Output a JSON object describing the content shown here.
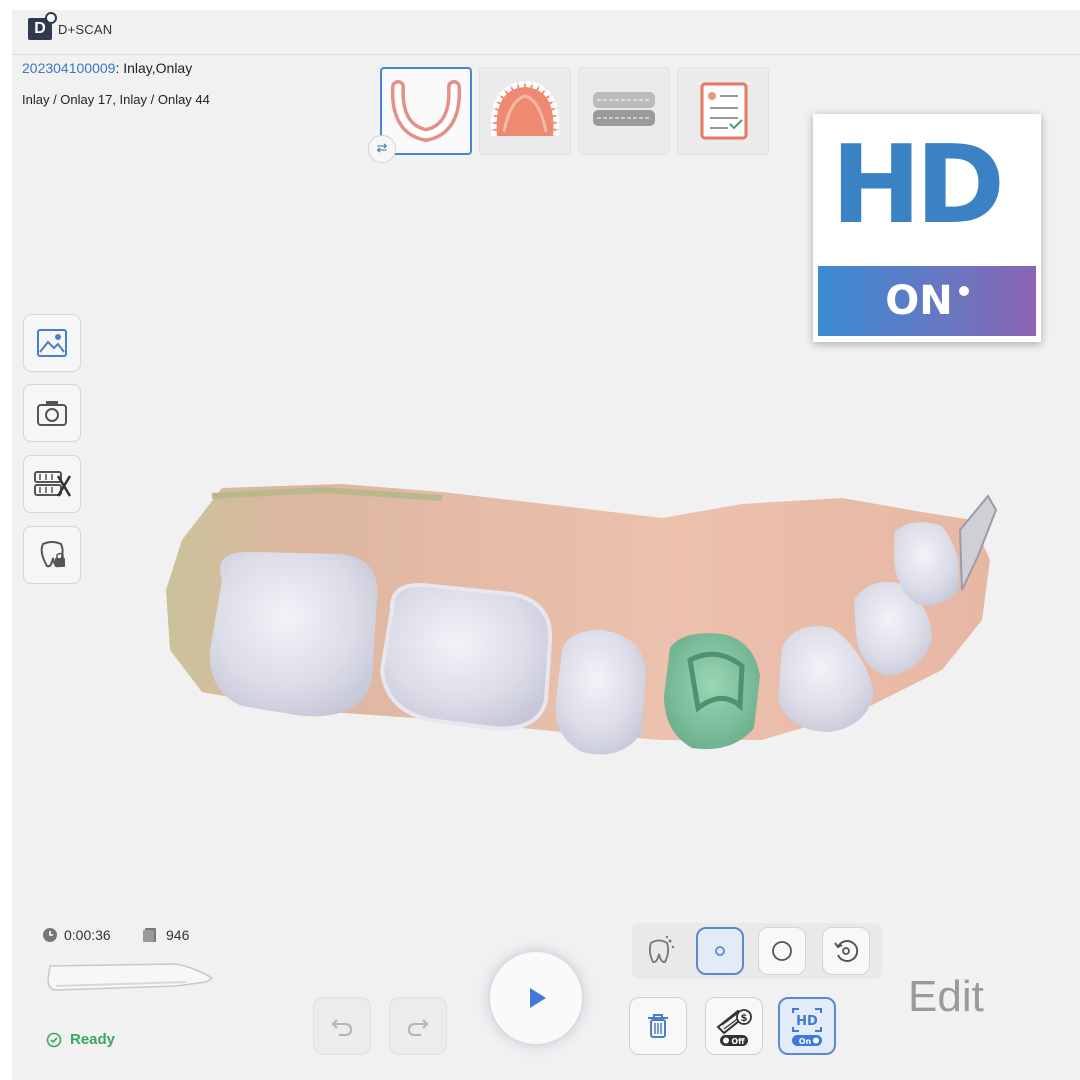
{
  "app": {
    "name": "D+SCAN",
    "logo_letter": "D"
  },
  "case": {
    "id": "202304100009",
    "separator": ":",
    "types": "Inlay,Onlay",
    "detail": "Inlay / Onlay 17, Inlay / Onlay 44"
  },
  "tabs": [
    {
      "name": "lower-jaw",
      "active": true
    },
    {
      "name": "upper-jaw",
      "active": false
    },
    {
      "name": "occlusion",
      "active": false
    },
    {
      "name": "order-form",
      "active": false
    }
  ],
  "hd_badge": {
    "title": "HD",
    "status": "ON"
  },
  "left_tools": [
    "image-icon",
    "camera-icon",
    "trim-icon",
    "tooth-lock-icon"
  ],
  "status": {
    "timer": "0:00:36",
    "frames": "946",
    "ready": "Ready"
  },
  "bottom_tools": {
    "ai_filter_label": "$",
    "ai_filter_state": "Off",
    "hd_label": "HD",
    "hd_state": "On"
  },
  "mode": {
    "label": "Edit"
  },
  "colors": {
    "accent": "#4a84d6",
    "ready": "#3aa564",
    "id_link": "#3c78c3",
    "selected_tooth": "#7fc4a0"
  }
}
